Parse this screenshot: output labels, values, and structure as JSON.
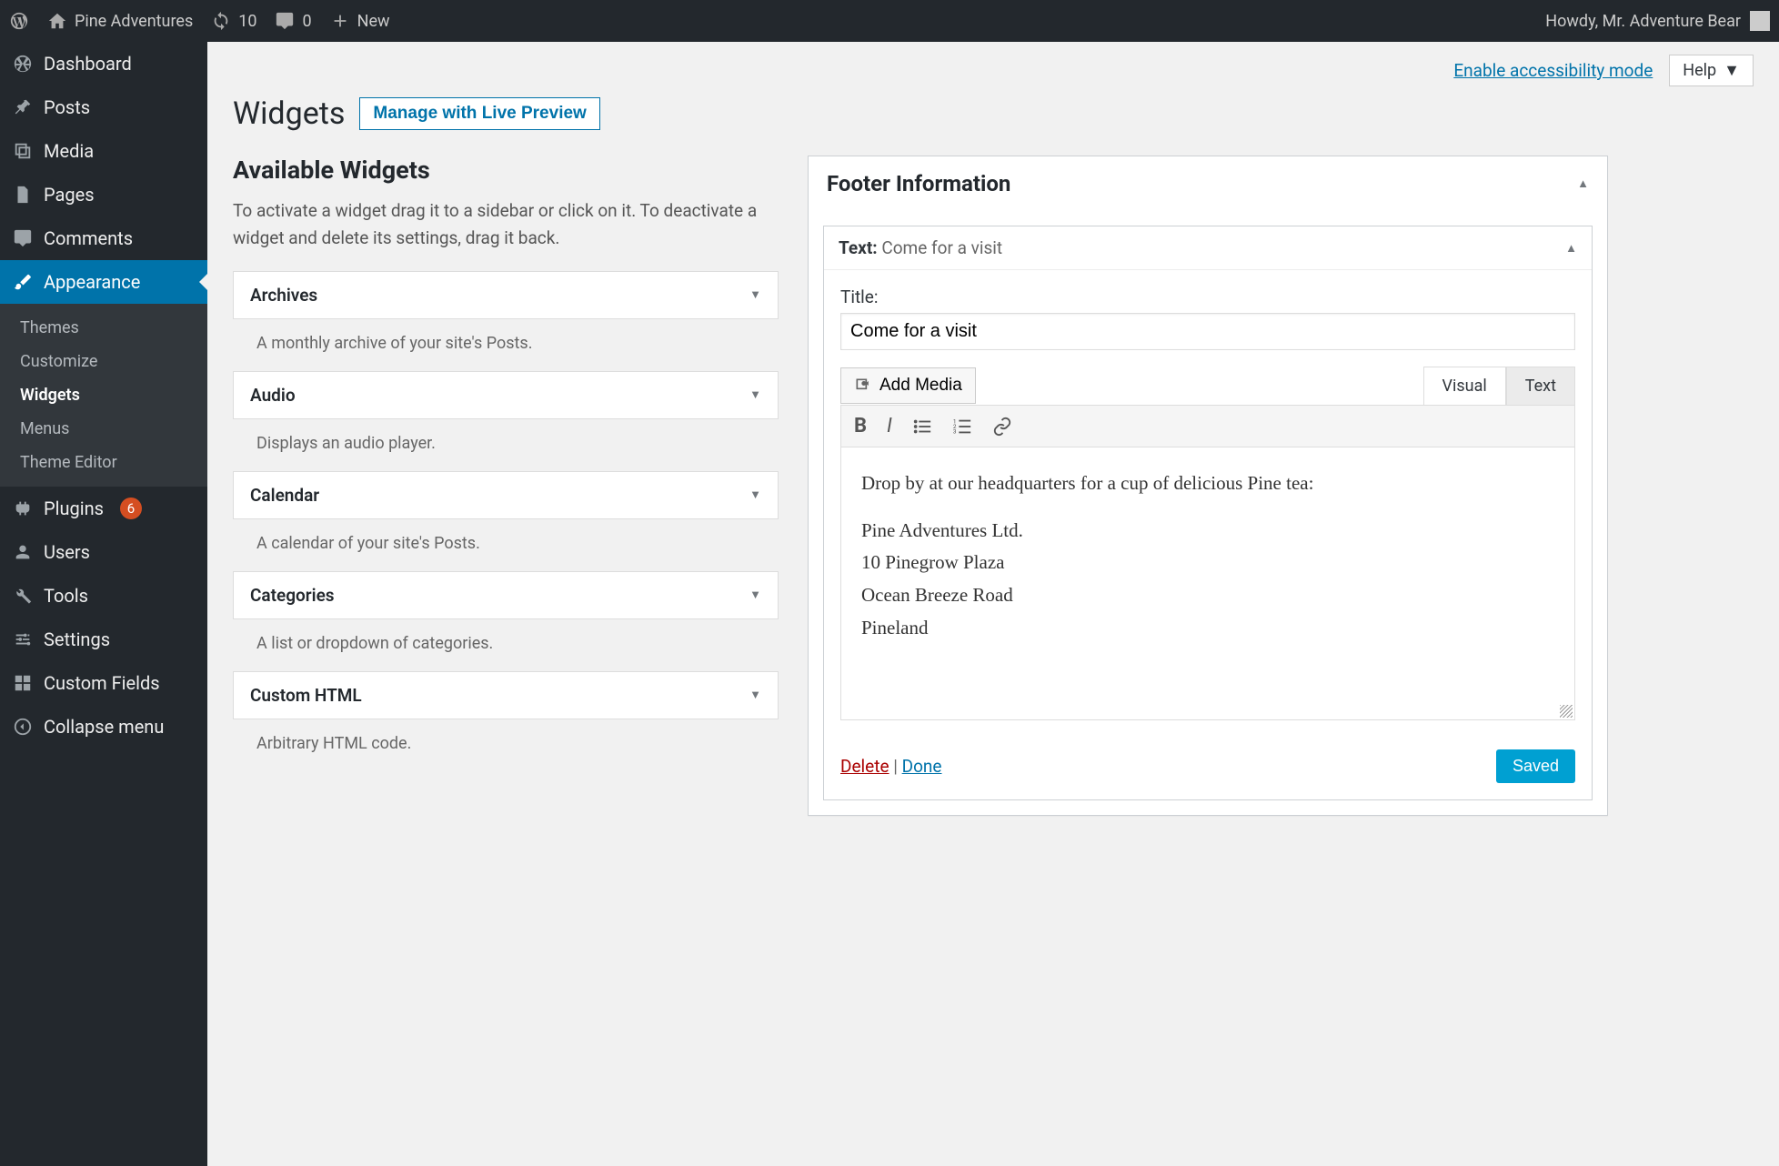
{
  "adminbar": {
    "site_name": "Pine Adventures",
    "updates_count": "10",
    "comments_count": "0",
    "new_label": "New",
    "howdy": "Howdy, Mr. Adventure Bear"
  },
  "sidebar": {
    "items": [
      {
        "label": "Dashboard"
      },
      {
        "label": "Posts"
      },
      {
        "label": "Media"
      },
      {
        "label": "Pages"
      },
      {
        "label": "Comments"
      },
      {
        "label": "Appearance"
      },
      {
        "label": "Plugins",
        "badge": "6"
      },
      {
        "label": "Users"
      },
      {
        "label": "Tools"
      },
      {
        "label": "Settings"
      },
      {
        "label": "Custom Fields"
      },
      {
        "label": "Collapse menu"
      }
    ],
    "submenu": [
      {
        "label": "Themes"
      },
      {
        "label": "Customize"
      },
      {
        "label": "Widgets"
      },
      {
        "label": "Menus"
      },
      {
        "label": "Theme Editor"
      }
    ]
  },
  "top": {
    "accessibility": "Enable accessibility mode",
    "help": "Help"
  },
  "page": {
    "title": "Widgets",
    "live_preview": "Manage with Live Preview"
  },
  "available": {
    "title": "Available Widgets",
    "desc": "To activate a widget drag it to a sidebar or click on it. To deactivate a widget and delete its settings, drag it back.",
    "items": [
      {
        "title": "Archives",
        "desc": "A monthly archive of your site's Posts."
      },
      {
        "title": "Audio",
        "desc": "Displays an audio player."
      },
      {
        "title": "Calendar",
        "desc": "A calendar of your site's Posts."
      },
      {
        "title": "Categories",
        "desc": "A list or dropdown of categories."
      },
      {
        "title": "Custom HTML",
        "desc": "Arbitrary HTML code."
      }
    ]
  },
  "panel": {
    "title": "Footer Information"
  },
  "widget": {
    "type_label": "Text",
    "name": "Come for a visit",
    "title_label": "Title:",
    "title_value": "Come for a visit",
    "add_media": "Add Media",
    "tabs": {
      "visual": "Visual",
      "text": "Text"
    },
    "content_p1": "Drop by at our headquarters for a cup of delicious Pine tea:",
    "content_line1": "Pine Adventures Ltd.",
    "content_line2": "10 Pinegrow Plaza",
    "content_line3": "Ocean Breeze Road",
    "content_line4": "Pineland",
    "delete": "Delete",
    "done": "Done",
    "saved": "Saved"
  }
}
